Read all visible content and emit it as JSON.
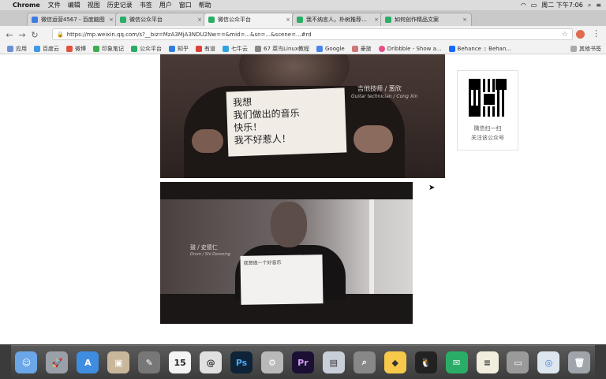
{
  "menubar": {
    "app": "Chrome",
    "items": [
      "文件",
      "编辑",
      "视图",
      "历史记录",
      "书签",
      "用户",
      "窗口",
      "帮助"
    ],
    "clock": "周二 下午7:06"
  },
  "tabs": [
    {
      "label": "微信运营4567 - 百度脑图",
      "active": false
    },
    {
      "label": "微信公众平台",
      "active": false
    },
    {
      "label": "微信公众平台",
      "active": true
    },
    {
      "label": "我不纳言人，朴树推荐的电影",
      "active": false
    },
    {
      "label": "如何创作精品文案",
      "active": false
    }
  ],
  "toolbar": {
    "url": "https://mp.weixin.qq.com/s?__biz=MzA3MjA3NDU2Nw==&mid=...&sn=...&scene=...#rd"
  },
  "bookmarks": {
    "items": [
      "应用",
      "百度云",
      "微博",
      "印象笔记",
      "公众平台",
      "知乎",
      "有道",
      "七牛云",
      "67 菜鸟Linux教程",
      "Google",
      "豪旅",
      "Dribbble - Show a...",
      "Behance :: Behan..."
    ],
    "other": "其他书签"
  },
  "article": {
    "photo1": {
      "caption": "吉他技师 / 葱欣",
      "caption_en": "Guitar technician / Cong Xin",
      "sign_lines": [
        "我想",
        "我们做出的音乐",
        "快乐！",
        "我不好惹人！"
      ]
    },
    "photo2": {
      "caption": "鼓 / 史德仁",
      "caption_en": "Drum / Shi Derening",
      "sign_text": "我想做一个好音乐"
    }
  },
  "qr": {
    "line1": "微信扫一扫",
    "line2": "关注该公众号"
  },
  "dock": {
    "items": [
      "finder-icon",
      "launchpad-icon",
      "app-store-icon",
      "preview-icon",
      "brush-icon",
      "calendar-icon",
      "at-icon",
      "photoshop-icon",
      "settings-icon",
      "premiere-icon",
      "keynote-icon",
      "search-icon",
      "sketch-icon",
      "qq-icon",
      "wechat-icon",
      "notes-icon",
      "keychain-icon",
      "chrome-icon",
      "trash-icon"
    ],
    "calendar_day": "15",
    "ps_label": "Ps",
    "pr_label": "Pr"
  },
  "colors": {
    "accent_green": "#2aae67",
    "page_bg": "#ffffff",
    "chrome_tab": "#d9d9d9"
  }
}
